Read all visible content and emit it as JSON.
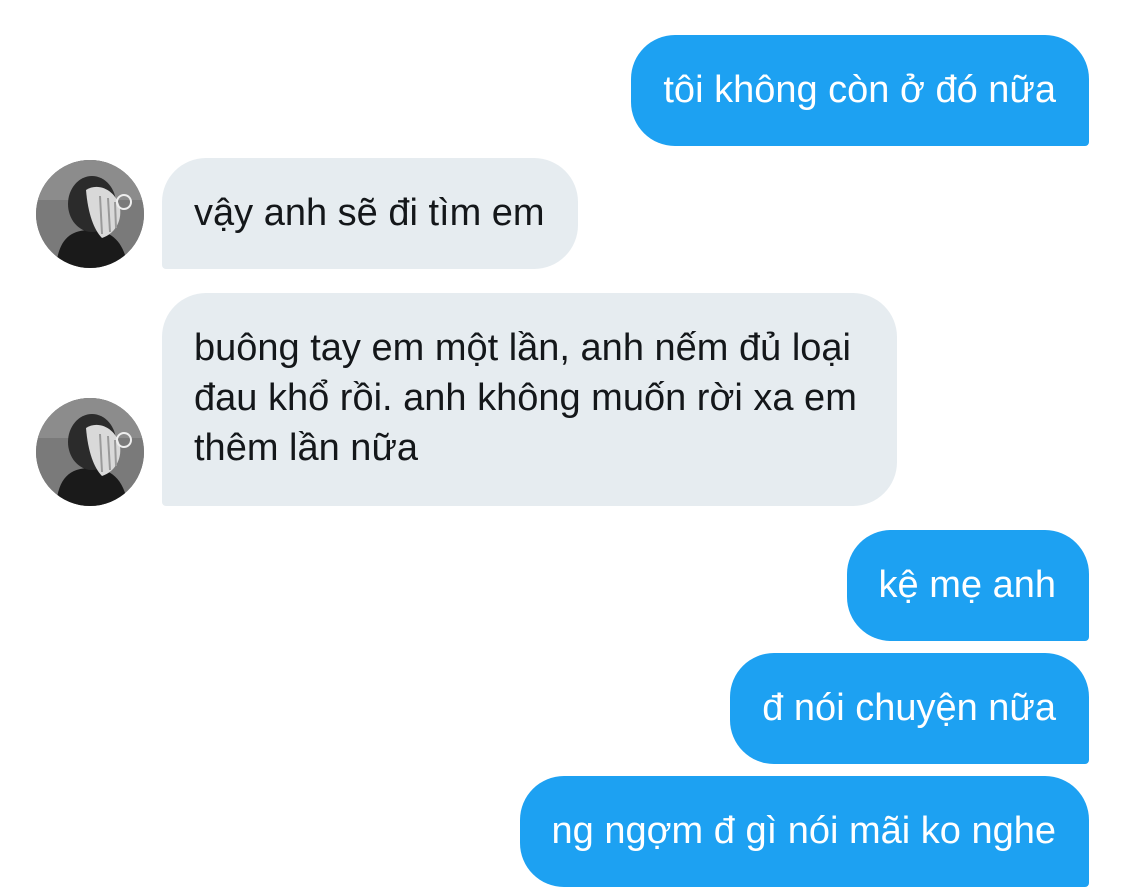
{
  "conversation": {
    "messages": [
      {
        "direction": "outgoing",
        "text": "tôi không còn ở đó nữa"
      },
      {
        "direction": "incoming",
        "text": "vậy anh sẽ đi tìm em"
      },
      {
        "direction": "incoming",
        "text": "buông tay em một lần, anh nếm đủ loại đau khổ rồi. anh không muốn rời xa em thêm lần nữa"
      },
      {
        "direction": "outgoing",
        "text": "kệ mẹ anh"
      },
      {
        "direction": "outgoing",
        "text": "đ nói chuyện nữa"
      },
      {
        "direction": "outgoing",
        "text": "ng ngợm đ gì nói mãi ko nghe"
      }
    ]
  },
  "colors": {
    "outgoing_bubble": "#1da1f2",
    "incoming_bubble": "#e6ecf0",
    "incoming_text": "#14171a",
    "outgoing_text": "#ffffff"
  },
  "icons": {
    "avatar": "contact-avatar-photo"
  }
}
